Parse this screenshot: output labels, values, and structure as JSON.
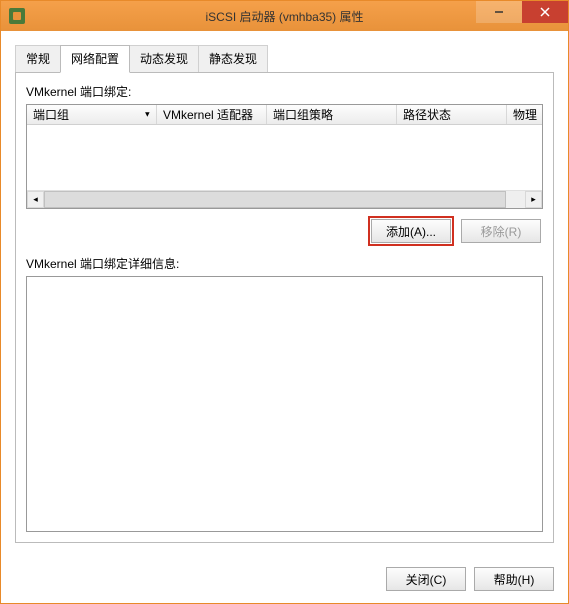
{
  "window": {
    "title": "iSCSI 启动器 (vmhba35) 属性"
  },
  "tabs": {
    "general": "常规",
    "network": "网络配置",
    "dynamic_discovery": "动态发现",
    "static_discovery": "静态发现"
  },
  "section": {
    "binding_label": "VMkernel 端口绑定:",
    "details_label": "VMkernel 端口绑定详细信息:"
  },
  "table": {
    "columns": {
      "port_group": "端口组",
      "vmk_adapter": "VMkernel 适配器",
      "port_policy": "端口组策略",
      "path_status": "路径状态",
      "physical": "物理"
    }
  },
  "buttons": {
    "add": "添加(A)...",
    "remove": "移除(R)",
    "close": "关闭(C)",
    "help": "帮助(H)"
  }
}
